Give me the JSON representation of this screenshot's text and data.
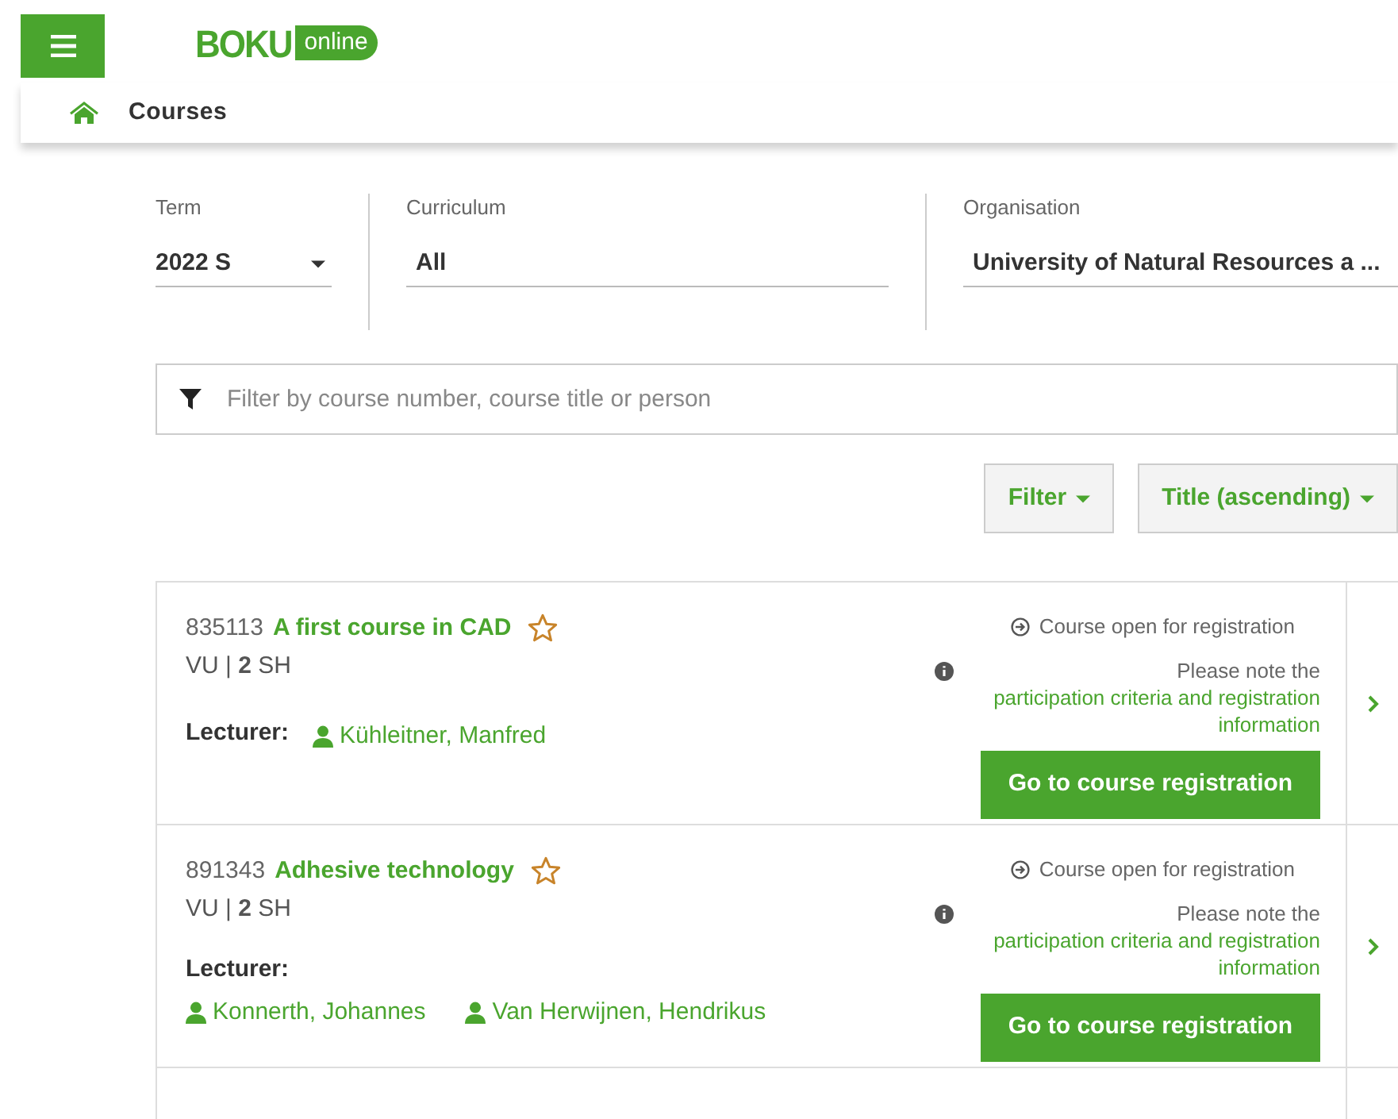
{
  "header": {
    "logo": {
      "word": "BOKU",
      "badge": "online"
    }
  },
  "breadcrumb": {
    "label": "Courses"
  },
  "selectors": [
    {
      "kind": "select",
      "label": "Term",
      "value": "2022 S"
    },
    {
      "kind": "text",
      "label": "Curriculum",
      "value": "All"
    },
    {
      "kind": "text",
      "label": "Organisation",
      "value": "University of Natural Resources a  ..."
    }
  ],
  "search": {
    "placeholder": "Filter by course number, course title or person"
  },
  "toolbar": {
    "buttons": [
      "Filter",
      "Title (ascending)"
    ]
  },
  "courses": [
    {
      "number": "835113",
      "title": "A first course in CAD",
      "favorite": false,
      "type": "VU | **2** SH",
      "lecturer_label": "Lecturer:",
      "lecturers": [
        "Kühleitner, Manfred"
      ],
      "status": "Course open for registration",
      "note": "Please note the",
      "note_link": "participation criteria and registration information",
      "action": "Go to course registration"
    },
    {
      "number": "891343",
      "title": "Adhesive technology",
      "favorite": false,
      "type": "VU | **2** SH",
      "lecturer_label": "Lecturer:",
      "lecturers": [
        "Konnerth, Johannes",
        "Van Herwijnen, Hendrikus"
      ],
      "status": "Course open for registration",
      "note": "Please note the",
      "note_link": "participation criteria and registration information",
      "action": "Go to course registration"
    }
  ]
}
